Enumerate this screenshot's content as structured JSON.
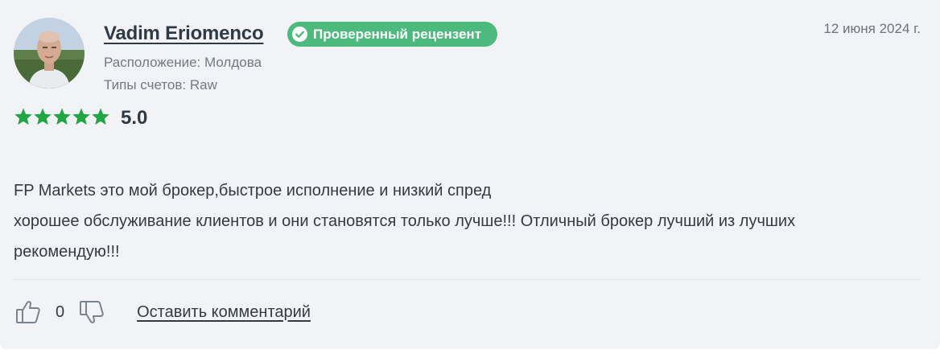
{
  "review": {
    "reviewer_name": "Vadim Eriomenco",
    "verified_badge": "Проверенный рецензент",
    "date": "12 июня 2024 г.",
    "location": "Расположение: Молдова",
    "account_types": "Типы счетов: Raw",
    "rating": {
      "value": "5.0",
      "stars_filled": 5,
      "stars_total": 5
    },
    "text_lines": [
      "FP Markets это мой брокер,быстрое исполнение и низкий спред",
      "хорошее обслуживание клиентов и они становятся только лучше!!! Отличный брокер лучший из лучших",
      "рекомендую!!!"
    ]
  },
  "actions": {
    "like_count": "0",
    "comment_link": "Оставить комментарий"
  },
  "colors": {
    "card_bg": "#f2f3f6",
    "badge_green": "#4dba7d",
    "star_green": "#22a645",
    "icon_gray": "#7b838c"
  },
  "icons": [
    "check-circle-icon",
    "star-icon",
    "thumbs-up-icon",
    "thumbs-down-icon"
  ]
}
